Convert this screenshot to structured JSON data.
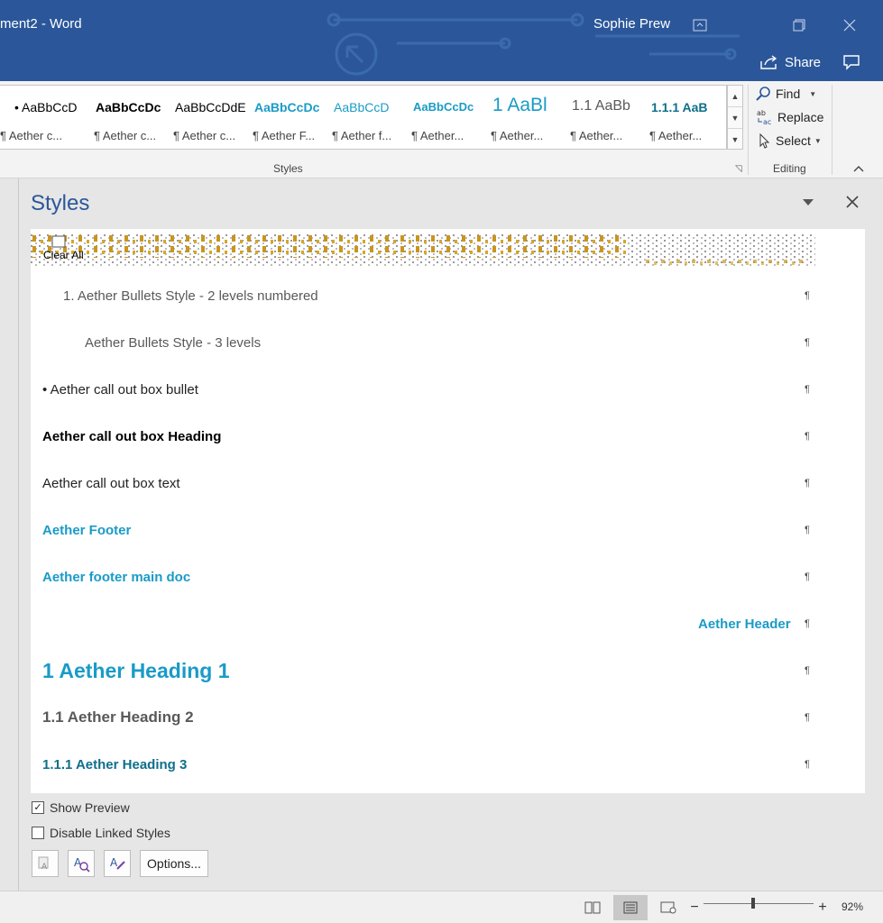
{
  "window": {
    "title": "ment2  -  Word",
    "user": "Sophie Prew",
    "share_label": "Share",
    "accent": "#2b579a"
  },
  "ribbon": {
    "gallery": [
      {
        "sample": "•  AaBbCcD",
        "name": "¶ Aether c..."
      },
      {
        "sample": "AaBbCcDc",
        "name": "¶ Aether c..."
      },
      {
        "sample": "AaBbCcDdE",
        "name": "¶ Aether c..."
      },
      {
        "sample": "AaBbCcDc",
        "name": "¶ Aether F..."
      },
      {
        "sample": "AaBbCcD",
        "name": "¶ Aether f..."
      },
      {
        "sample": "AaBbCcDc",
        "name": "¶ Aether..."
      },
      {
        "sample": "1  AaBl",
        "name": "¶ Aether..."
      },
      {
        "sample": "1.1  AaBb",
        "name": "¶ Aether..."
      },
      {
        "sample": "1.1.1  AaB",
        "name": "¶ Aether..."
      }
    ],
    "styles_group": "Styles",
    "editing_group": "Editing",
    "find": "Find",
    "replace": "Replace",
    "select": "Select"
  },
  "pane": {
    "title": "Styles",
    "clear_all": "Clear All",
    "rows": [
      {
        "label": "1.  Aether Bullets Style - 2 levels numbered"
      },
      {
        "label": "Aether Bullets Style - 3 levels"
      },
      {
        "label": "•  Aether call out box bullet"
      },
      {
        "label": "Aether call out box Heading"
      },
      {
        "label": "Aether call out box text"
      },
      {
        "label": "Aether Footer"
      },
      {
        "label": "Aether footer main doc"
      },
      {
        "label": "Aether Header"
      },
      {
        "label": "1  Aether Heading 1"
      },
      {
        "label": "1.1  Aether Heading 2"
      },
      {
        "label": "1.1.1  Aether Heading 3"
      }
    ],
    "pilcrow": "¶",
    "show_preview": "Show Preview",
    "show_preview_checked": true,
    "disable_linked": "Disable Linked Styles",
    "disable_linked_checked": false,
    "options_label": "Options..."
  },
  "status": {
    "zoom": "92%"
  },
  "colors": {
    "teal": "#1a9bc7",
    "dark_teal": "#0e6f8a",
    "gray_heading": "#595959"
  }
}
